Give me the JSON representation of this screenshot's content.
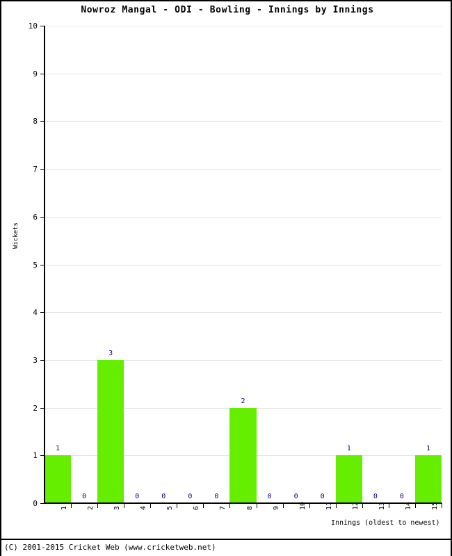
{
  "chart_data": {
    "type": "bar",
    "title": "Nowroz Mangal - ODI - Bowling - Innings by Innings",
    "xlabel": "Innings (oldest to newest)",
    "ylabel": "Wickets",
    "categories": [
      "1",
      "2",
      "3",
      "4",
      "5",
      "6",
      "7",
      "8",
      "9",
      "10",
      "11",
      "12",
      "13",
      "14",
      "15"
    ],
    "values": [
      1,
      0,
      3,
      0,
      0,
      0,
      0,
      2,
      0,
      0,
      0,
      1,
      0,
      0,
      1
    ],
    "data_labels": [
      "1",
      "0",
      "3",
      "0",
      "0",
      "0",
      "0",
      "2",
      "0",
      "0",
      "0",
      "1",
      "0",
      "0",
      "1"
    ],
    "ylim": [
      0,
      10
    ],
    "ytick_labels": [
      "0",
      "1",
      "2",
      "3",
      "4",
      "5",
      "6",
      "7",
      "8",
      "9",
      "10"
    ],
    "ytick_values": [
      0,
      1,
      2,
      3,
      4,
      5,
      6,
      7,
      8,
      9,
      10
    ],
    "grid": true,
    "legend": false,
    "bar_color": "#66ee00",
    "data_label_color": "#00008b",
    "grid_color": "#e3e3e3",
    "axis_color": "#000000"
  },
  "footer": {
    "copyright": "(C) 2001-2015 Cricket Web (www.cricketweb.net)"
  }
}
